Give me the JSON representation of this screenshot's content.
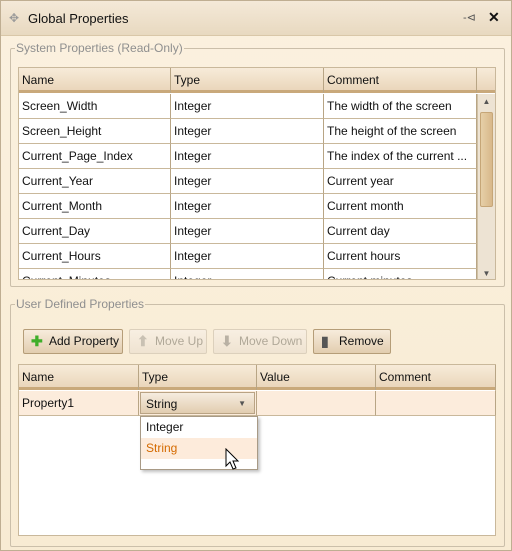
{
  "window": {
    "title": "Global Properties",
    "move_icon": "move-icon",
    "pin_icon": "pin-icon",
    "close_icon": "close-icon"
  },
  "system": {
    "legend": "System Properties (Read-Only)",
    "columns": [
      "Name",
      "Type",
      "Comment"
    ],
    "rows": [
      [
        "Screen_Width",
        "Integer",
        "The width of the screen"
      ],
      [
        "Screen_Height",
        "Integer",
        "The height of the screen"
      ],
      [
        "Current_Page_Index",
        "Integer",
        "The index of the current ..."
      ],
      [
        "Current_Year",
        "Integer",
        "Current year"
      ],
      [
        "Current_Month",
        "Integer",
        "Current month"
      ],
      [
        "Current_Day",
        "Integer",
        "Current day"
      ],
      [
        "Current_Hours",
        "Integer",
        "Current hours"
      ],
      [
        "Current_Minutes",
        "Integer",
        "Current minutes"
      ]
    ]
  },
  "user": {
    "legend": "User Defined Properties",
    "buttons": {
      "add": "Add Property",
      "up": "Move Up",
      "down": "Move Down",
      "remove": "Remove"
    },
    "columns": [
      "Name",
      "Type",
      "Value",
      "Comment"
    ],
    "rows": [
      [
        "Property1",
        "String",
        "",
        ""
      ]
    ],
    "type_options": [
      "Integer",
      "String"
    ],
    "selected_option": "String",
    "highlight_color": "#d46a00"
  }
}
